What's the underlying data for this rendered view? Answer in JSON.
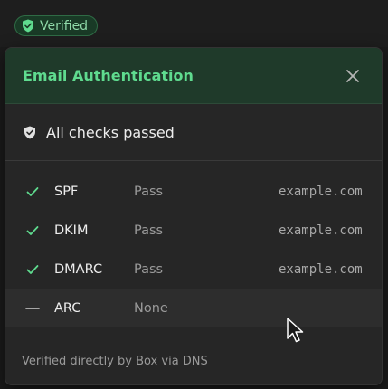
{
  "badge": {
    "label": "Verified",
    "icon": "shield-check-icon",
    "color": "#5fdb8f"
  },
  "popover": {
    "title": "Email Authentication",
    "close_icon": "close-icon",
    "summary": {
      "icon": "shield-check-icon",
      "text": "All checks passed"
    },
    "checks": [
      {
        "name": "SPF",
        "result": "Pass",
        "domain": "example.com",
        "status_icon": "check-icon"
      },
      {
        "name": "DKIM",
        "result": "Pass",
        "domain": "example.com",
        "status_icon": "check-icon"
      },
      {
        "name": "DMARC",
        "result": "Pass",
        "domain": "example.com",
        "status_icon": "check-icon"
      },
      {
        "name": "ARC",
        "result": "None",
        "domain": "",
        "status_icon": "dash-icon"
      }
    ],
    "footer": "Verified directly by Box via DNS"
  },
  "colors": {
    "accent": "#5fdb8f",
    "header_bg": "#1f3a2a",
    "panel_bg": "#262626"
  }
}
